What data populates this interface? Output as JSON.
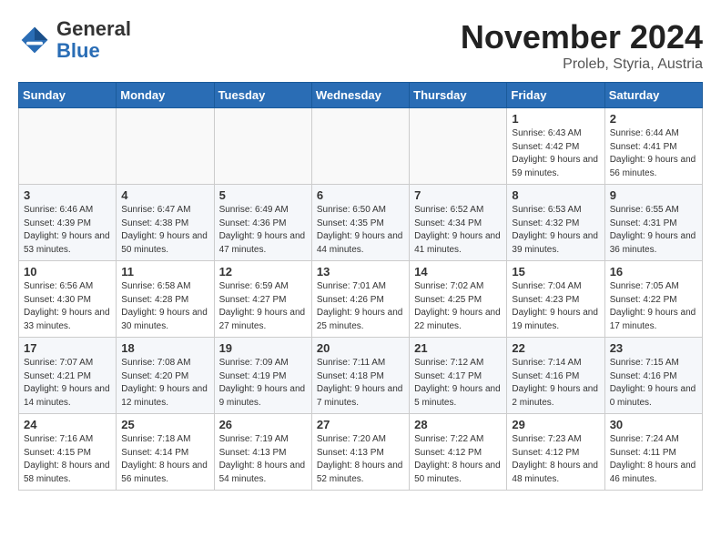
{
  "header": {
    "logo_line1": "General",
    "logo_line2": "Blue",
    "cal_title": "November 2024",
    "cal_subtitle": "Proleb, Styria, Austria"
  },
  "days_of_week": [
    "Sunday",
    "Monday",
    "Tuesday",
    "Wednesday",
    "Thursday",
    "Friday",
    "Saturday"
  ],
  "weeks": [
    [
      {
        "day": "",
        "info": ""
      },
      {
        "day": "",
        "info": ""
      },
      {
        "day": "",
        "info": ""
      },
      {
        "day": "",
        "info": ""
      },
      {
        "day": "",
        "info": ""
      },
      {
        "day": "1",
        "info": "Sunrise: 6:43 AM\nSunset: 4:42 PM\nDaylight: 9 hours and 59 minutes."
      },
      {
        "day": "2",
        "info": "Sunrise: 6:44 AM\nSunset: 4:41 PM\nDaylight: 9 hours and 56 minutes."
      }
    ],
    [
      {
        "day": "3",
        "info": "Sunrise: 6:46 AM\nSunset: 4:39 PM\nDaylight: 9 hours and 53 minutes."
      },
      {
        "day": "4",
        "info": "Sunrise: 6:47 AM\nSunset: 4:38 PM\nDaylight: 9 hours and 50 minutes."
      },
      {
        "day": "5",
        "info": "Sunrise: 6:49 AM\nSunset: 4:36 PM\nDaylight: 9 hours and 47 minutes."
      },
      {
        "day": "6",
        "info": "Sunrise: 6:50 AM\nSunset: 4:35 PM\nDaylight: 9 hours and 44 minutes."
      },
      {
        "day": "7",
        "info": "Sunrise: 6:52 AM\nSunset: 4:34 PM\nDaylight: 9 hours and 41 minutes."
      },
      {
        "day": "8",
        "info": "Sunrise: 6:53 AM\nSunset: 4:32 PM\nDaylight: 9 hours and 39 minutes."
      },
      {
        "day": "9",
        "info": "Sunrise: 6:55 AM\nSunset: 4:31 PM\nDaylight: 9 hours and 36 minutes."
      }
    ],
    [
      {
        "day": "10",
        "info": "Sunrise: 6:56 AM\nSunset: 4:30 PM\nDaylight: 9 hours and 33 minutes."
      },
      {
        "day": "11",
        "info": "Sunrise: 6:58 AM\nSunset: 4:28 PM\nDaylight: 9 hours and 30 minutes."
      },
      {
        "day": "12",
        "info": "Sunrise: 6:59 AM\nSunset: 4:27 PM\nDaylight: 9 hours and 27 minutes."
      },
      {
        "day": "13",
        "info": "Sunrise: 7:01 AM\nSunset: 4:26 PM\nDaylight: 9 hours and 25 minutes."
      },
      {
        "day": "14",
        "info": "Sunrise: 7:02 AM\nSunset: 4:25 PM\nDaylight: 9 hours and 22 minutes."
      },
      {
        "day": "15",
        "info": "Sunrise: 7:04 AM\nSunset: 4:23 PM\nDaylight: 9 hours and 19 minutes."
      },
      {
        "day": "16",
        "info": "Sunrise: 7:05 AM\nSunset: 4:22 PM\nDaylight: 9 hours and 17 minutes."
      }
    ],
    [
      {
        "day": "17",
        "info": "Sunrise: 7:07 AM\nSunset: 4:21 PM\nDaylight: 9 hours and 14 minutes."
      },
      {
        "day": "18",
        "info": "Sunrise: 7:08 AM\nSunset: 4:20 PM\nDaylight: 9 hours and 12 minutes."
      },
      {
        "day": "19",
        "info": "Sunrise: 7:09 AM\nSunset: 4:19 PM\nDaylight: 9 hours and 9 minutes."
      },
      {
        "day": "20",
        "info": "Sunrise: 7:11 AM\nSunset: 4:18 PM\nDaylight: 9 hours and 7 minutes."
      },
      {
        "day": "21",
        "info": "Sunrise: 7:12 AM\nSunset: 4:17 PM\nDaylight: 9 hours and 5 minutes."
      },
      {
        "day": "22",
        "info": "Sunrise: 7:14 AM\nSunset: 4:16 PM\nDaylight: 9 hours and 2 minutes."
      },
      {
        "day": "23",
        "info": "Sunrise: 7:15 AM\nSunset: 4:16 PM\nDaylight: 9 hours and 0 minutes."
      }
    ],
    [
      {
        "day": "24",
        "info": "Sunrise: 7:16 AM\nSunset: 4:15 PM\nDaylight: 8 hours and 58 minutes."
      },
      {
        "day": "25",
        "info": "Sunrise: 7:18 AM\nSunset: 4:14 PM\nDaylight: 8 hours and 56 minutes."
      },
      {
        "day": "26",
        "info": "Sunrise: 7:19 AM\nSunset: 4:13 PM\nDaylight: 8 hours and 54 minutes."
      },
      {
        "day": "27",
        "info": "Sunrise: 7:20 AM\nSunset: 4:13 PM\nDaylight: 8 hours and 52 minutes."
      },
      {
        "day": "28",
        "info": "Sunrise: 7:22 AM\nSunset: 4:12 PM\nDaylight: 8 hours and 50 minutes."
      },
      {
        "day": "29",
        "info": "Sunrise: 7:23 AM\nSunset: 4:12 PM\nDaylight: 8 hours and 48 minutes."
      },
      {
        "day": "30",
        "info": "Sunrise: 7:24 AM\nSunset: 4:11 PM\nDaylight: 8 hours and 46 minutes."
      }
    ]
  ]
}
